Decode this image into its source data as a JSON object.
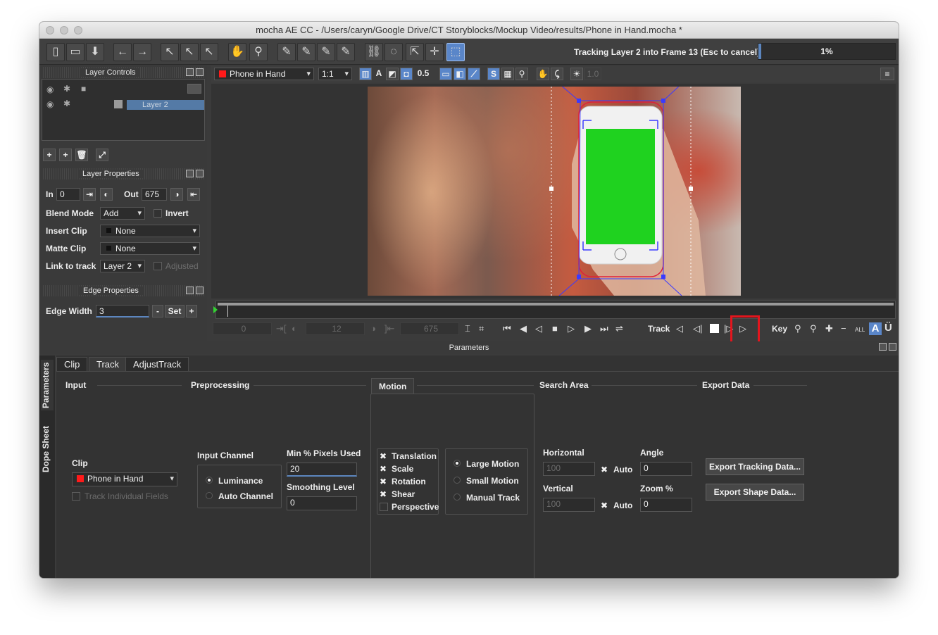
{
  "window": {
    "title": "mocha AE CC - /Users/caryn/Google Drive/CT Storyblocks/Mockup Video/results/Phone in Hand.mocha *"
  },
  "toolbar": {
    "status": "Tracking Layer 2 into Frame 13 (Esc to cancel)",
    "progress_label": "1%",
    "progress_value": 0.01
  },
  "layer_controls": {
    "title": "Layer Controls",
    "layer_name": "Layer 2"
  },
  "layer_properties": {
    "title": "Layer Properties",
    "in_label": "In",
    "in_value": "0",
    "out_label": "Out",
    "out_value": "675",
    "blend_mode_label": "Blend Mode",
    "blend_mode_value": "Add",
    "invert_label": "Invert",
    "insert_clip_label": "Insert Clip",
    "insert_clip_value": "None",
    "matte_clip_label": "Matte Clip",
    "matte_clip_value": "None",
    "link_to_track_label": "Link to track",
    "link_to_track_value": "Layer 2",
    "adjusted_label": "Adjusted"
  },
  "edge_properties": {
    "title": "Edge Properties",
    "edge_width_label": "Edge Width",
    "edge_width_value": "3",
    "minus_label": "-",
    "set_label": "Set",
    "plus_label": "+"
  },
  "viewer_bar": {
    "clip_name": "Phone in Hand",
    "zoom": "1:1",
    "channel_a": "A",
    "opacity": "0.5",
    "dim_value": "1.0"
  },
  "transport": {
    "frame_start": "0",
    "frame_current": "12",
    "frame_end": "675",
    "track_label": "Track",
    "key_label": "Key",
    "key_a": "A",
    "key_u": "Ü",
    "key_all": "ALL"
  },
  "parameters": {
    "header": "Parameters",
    "vtabs": [
      "Parameters",
      "Dope Sheet"
    ],
    "tabs": [
      "Clip",
      "Track",
      "AdjustTrack"
    ],
    "active_tab": "Track",
    "input": {
      "title": "Input",
      "clip_label": "Clip",
      "clip_value": "Phone in Hand",
      "track_individual_fields": "Track Individual Fields"
    },
    "preprocessing": {
      "title": "Preprocessing",
      "input_channel_label": "Input Channel",
      "luminance": "Luminance",
      "auto_channel": "Auto Channel",
      "min_pixels_label": "Min % Pixels Used",
      "min_pixels_value": "20",
      "smoothing_label": "Smoothing Level",
      "smoothing_value": "0"
    },
    "motion": {
      "title": "Motion",
      "translation": "Translation",
      "scale": "Scale",
      "rotation": "Rotation",
      "shear": "Shear",
      "perspective": "Perspective",
      "large_motion": "Large Motion",
      "small_motion": "Small Motion",
      "manual_track": "Manual Track"
    },
    "search_area": {
      "title": "Search Area",
      "horizontal_label": "Horizontal",
      "horizontal_value": "100",
      "vertical_label": "Vertical",
      "vertical_value": "100",
      "auto_label": "Auto",
      "angle_label": "Angle",
      "angle_value": "0",
      "zoom_label": "Zoom %",
      "zoom_value": "0"
    },
    "export_data": {
      "title": "Export Data",
      "export_tracking": "Export Tracking Data...",
      "export_shape": "Export Shape Data..."
    }
  }
}
